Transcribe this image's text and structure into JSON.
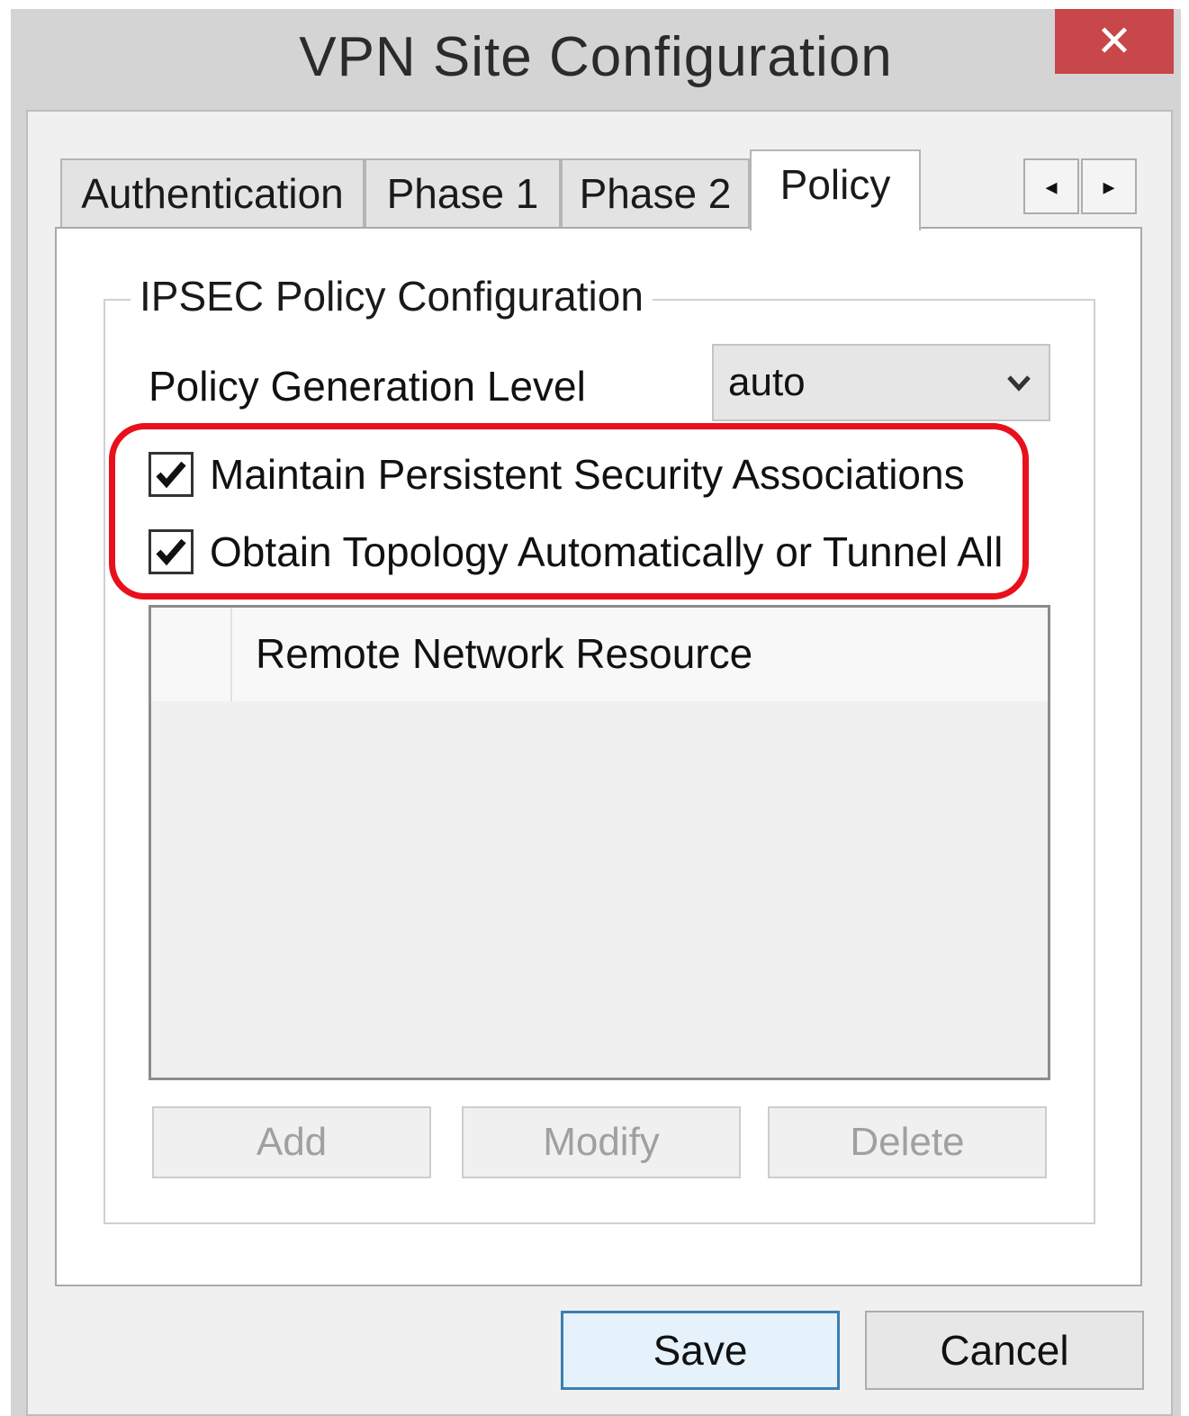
{
  "window": {
    "title": "VPN Site Configuration",
    "close_glyph": "✕"
  },
  "tabs": [
    {
      "label": "Authentication",
      "active": false
    },
    {
      "label": "Phase 1",
      "active": false
    },
    {
      "label": "Phase 2",
      "active": false
    },
    {
      "label": "Policy",
      "active": true
    }
  ],
  "tab_scroll": {
    "left_glyph": "◂",
    "right_glyph": "▸"
  },
  "group": {
    "title": "IPSEC Policy Configuration"
  },
  "policy_level": {
    "label": "Policy Generation Level",
    "value": "auto"
  },
  "checkboxes": [
    {
      "label": "Maintain Persistent Security Associations",
      "checked": true
    },
    {
      "label": "Obtain Topology Automatically or Tunnel All",
      "checked": true
    }
  ],
  "listview": {
    "column_header": "Remote Network Resource",
    "rows": []
  },
  "list_buttons": {
    "add": "Add",
    "modify": "Modify",
    "delete": "Delete"
  },
  "dialog_buttons": {
    "save": "Save",
    "cancel": "Cancel"
  },
  "colors": {
    "highlight": "#e8101c",
    "close_bg": "#c7474a",
    "default_button_border": "#3c7fb1"
  }
}
